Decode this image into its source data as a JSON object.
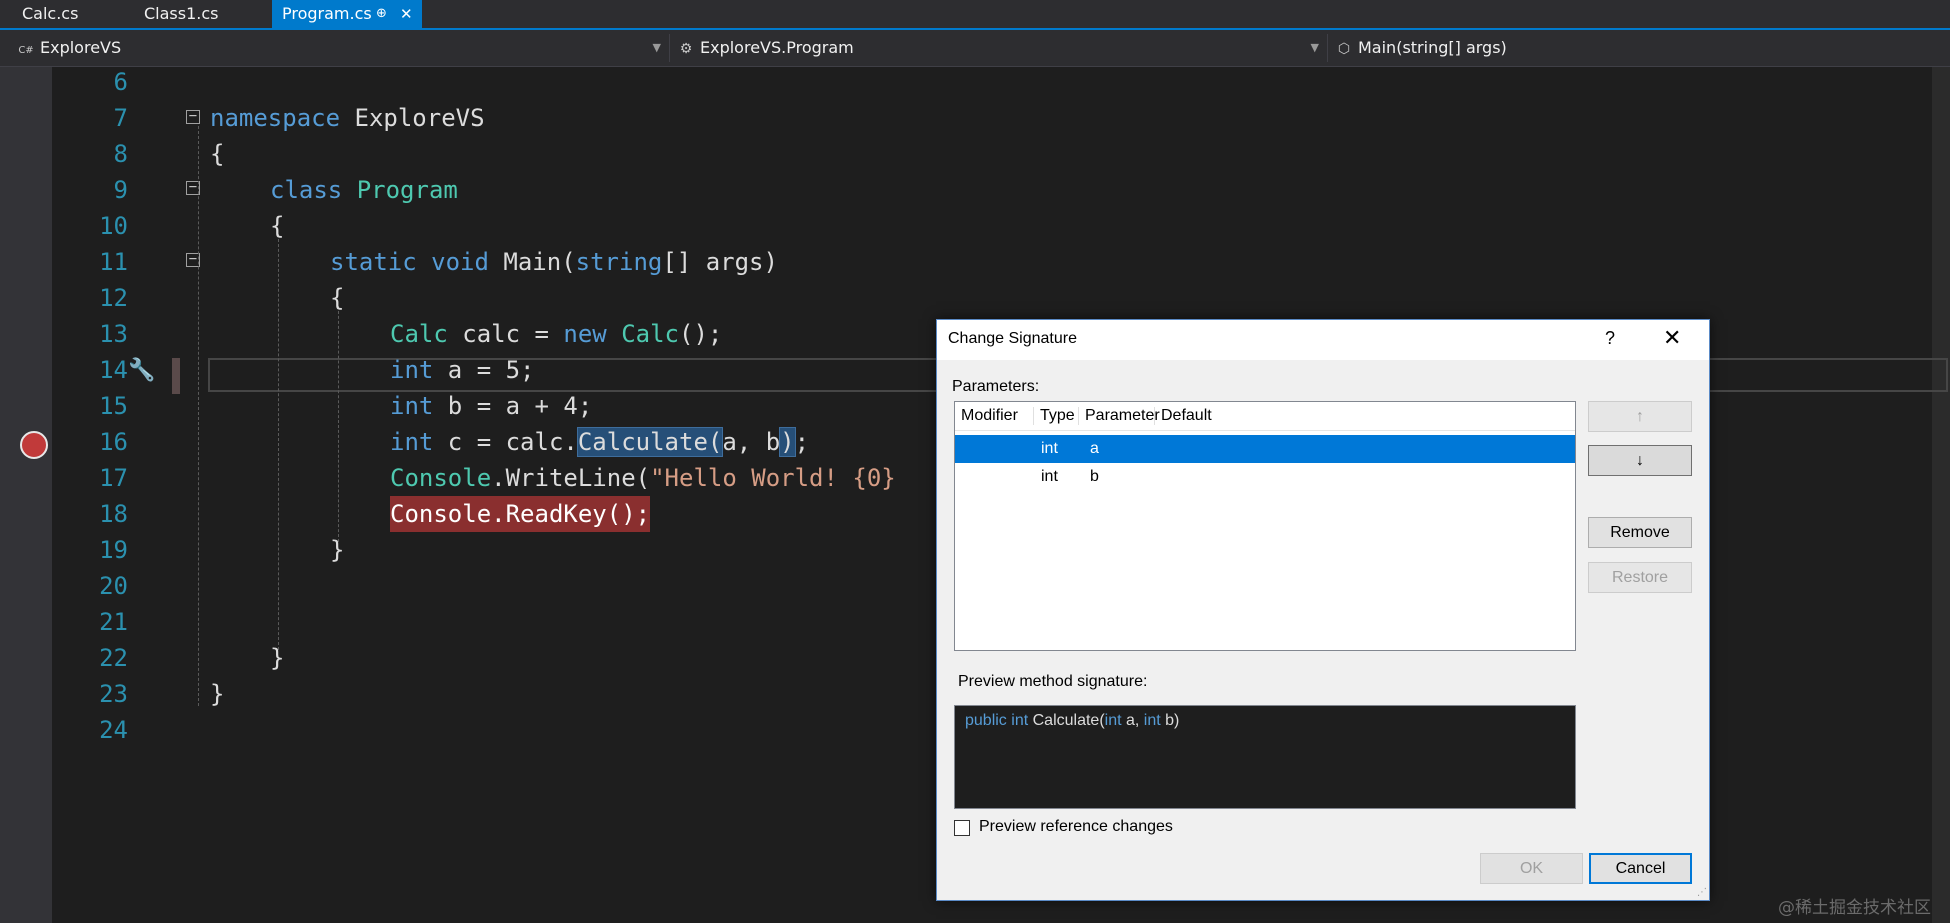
{
  "tabs": [
    {
      "label": "Calc.cs"
    },
    {
      "label": "Class1.cs"
    },
    {
      "label": "Program.cs",
      "pin": "⊕",
      "close": "✕"
    }
  ],
  "nav": {
    "project": {
      "icon": "C#",
      "label": "ExploreVS"
    },
    "type": {
      "icon": "⚙",
      "label": "ExploreVS.Program"
    },
    "member": {
      "icon": "⬡",
      "label": "Main(string[] args)"
    }
  },
  "editor": {
    "line_numbers": [
      "6",
      "7",
      "8",
      "9",
      "10",
      "11",
      "12",
      "13",
      "14",
      "15",
      "16",
      "17",
      "18",
      "19",
      "20",
      "21",
      "22",
      "23",
      "24"
    ],
    "code": {
      "l7_kw": "namespace",
      "l7_rest": " ExploreVS",
      "l8": "{",
      "l9_kw": "class",
      "l9_ty": "Program",
      "l10": "{",
      "l11_kw1": "static",
      "l11_kw2": "void",
      "l11_name": "Main(",
      "l11_kw3": "string",
      "l11_rest": "[] args)",
      "l12": "{",
      "l13_ty1": "Calc",
      "l13_mid": " calc = ",
      "l13_kw": "new",
      "l13_ty2": "Calc",
      "l13_end": "();",
      "l14_kw": "int",
      "l14_rest": " a = 5;",
      "l15_kw": "int",
      "l15_rest": " b = a + 4;",
      "l16_kw": "int",
      "l16_pre": " c = calc.",
      "l16_sel": "Calculate(",
      "l16_args": "a, b",
      "l16_close": ")",
      "l16_end": ";",
      "l17_ty": "Console",
      "l17_mid": ".WriteLine(",
      "l17_str": "\"Hello World! {0}",
      "l18": "Console.ReadKey();",
      "l19": "}",
      "l22": "}",
      "l23": "}"
    }
  },
  "dialog": {
    "title": "Change Signature",
    "help": "?",
    "close": "✕",
    "parameters_label": "Parameters:",
    "columns": [
      "Modifier",
      "Type",
      "Parameter",
      "Default"
    ],
    "rows": [
      {
        "modifier": "",
        "type": "int",
        "parameter": "a",
        "default": ""
      },
      {
        "modifier": "",
        "type": "int",
        "parameter": "b",
        "default": ""
      }
    ],
    "up_button": "↑",
    "down_button": "↓",
    "remove_button": "Remove",
    "restore_button": "Restore",
    "preview_label": "Preview method signature:",
    "preview": {
      "kw1": "public",
      "kw2": "int",
      "name": " Calculate(",
      "kw3": "int",
      "p1": " a, ",
      "kw4": "int",
      "p2": " b)"
    },
    "preview_refs_label": "Preview reference changes",
    "preview_refs_checked": false,
    "ok_button": "OK",
    "cancel_button": "Cancel"
  },
  "watermark": "@稀土掘金技术社区"
}
